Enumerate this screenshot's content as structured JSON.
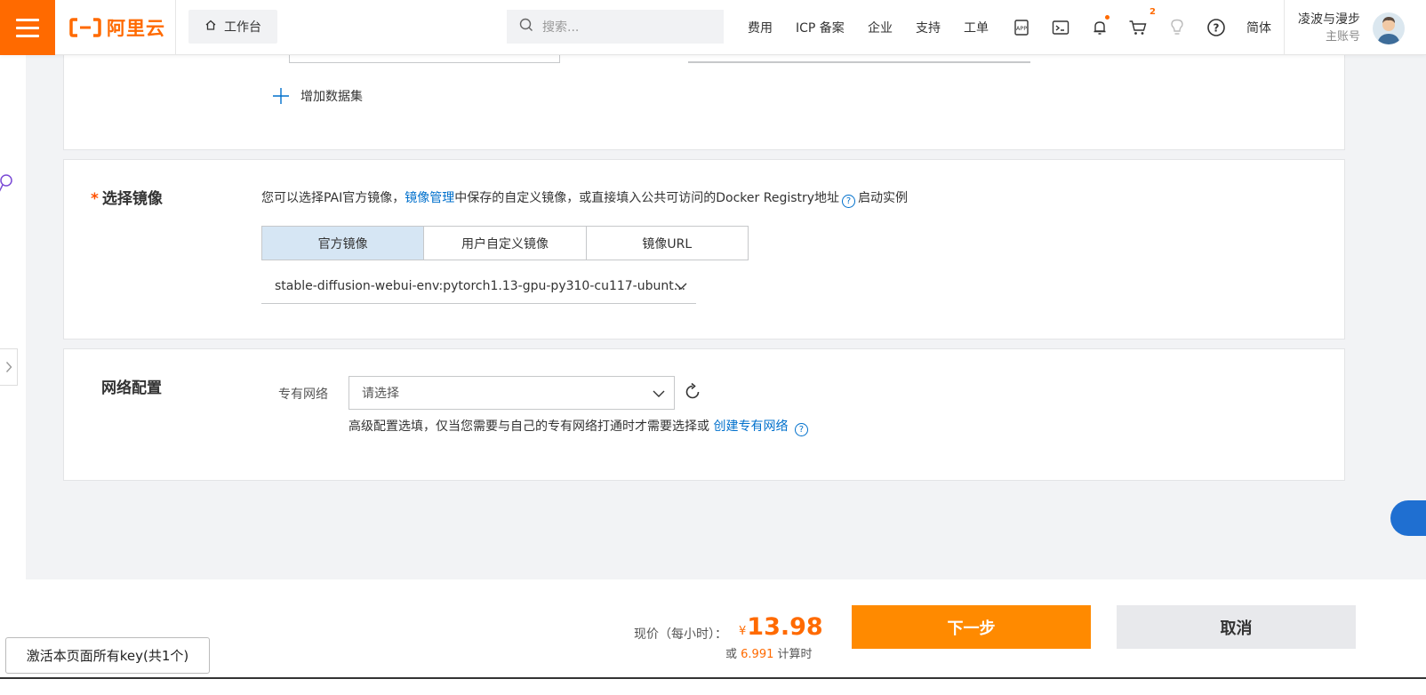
{
  "header": {
    "logo_text": "阿里云",
    "workbench_label": "工作台",
    "search_placeholder": "搜索...",
    "nav": [
      "费用",
      "ICP 备案",
      "企业",
      "支持",
      "工单"
    ],
    "cart_count": "2",
    "language": "简体",
    "user_name": "凌波与漫步",
    "user_role": "主账号",
    "accent_color": "#ff6a00"
  },
  "dataset": {
    "add_label": "增加数据集"
  },
  "image_section": {
    "title": "选择镜像",
    "desc_prefix": "您可以选择PAI官方镜像，",
    "desc_link": "镜像管理",
    "desc_suffix": "中保存的自定义镜像，或直接填入公共可访问的Docker Registry地址",
    "desc_tail": "启动实例",
    "tabs": [
      "官方镜像",
      "用户自定义镜像",
      "镜像URL"
    ],
    "active_tab": "官方镜像",
    "selected_image": "stable-diffusion-webui-env:pytorch1.13-gpu-py310-cu117-ubunt..."
  },
  "network_section": {
    "title": "网络配置",
    "vpc_label": "专有网络",
    "vpc_placeholder": "请选择",
    "hint_text": "高级配置选填，仅当您需要与自己的专有网络打通时才需要选择或",
    "hint_link": "创建专有网络"
  },
  "footer": {
    "price_label": "现价（每小时）：",
    "currency": "¥",
    "price": "13.98",
    "alt_prefix": "或",
    "alt_value": "6.991",
    "alt_suffix": "计算时",
    "next_button": "下一步",
    "cancel_button": "取消",
    "activate_keys_button": "激活本页面所有key(共1个)"
  }
}
